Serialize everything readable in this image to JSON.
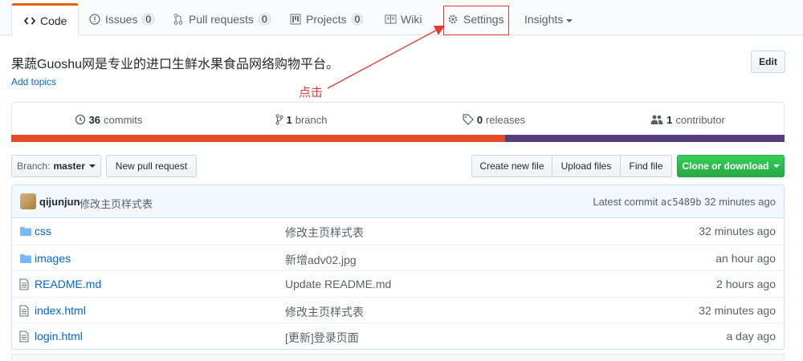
{
  "tabs": [
    {
      "label": "Code",
      "icon": "code-icon"
    },
    {
      "label": "Issues",
      "count": "0",
      "icon": "issue-icon"
    },
    {
      "label": "Pull requests",
      "count": "0",
      "icon": "pull-request-icon"
    },
    {
      "label": "Projects",
      "count": "0",
      "icon": "project-icon"
    },
    {
      "label": "Wiki",
      "icon": "book-icon"
    },
    {
      "label": "Settings",
      "icon": "gear-icon"
    },
    {
      "label": "Insights",
      "icon": "chevron-down-icon"
    }
  ],
  "repo": {
    "description": "果蔬Guoshu网是专业的进口生鲜水果食品网络购物平台。",
    "add_topics": "Add topics",
    "edit_label": "Edit"
  },
  "annotation": {
    "text": "点击",
    "color": "#e53935"
  },
  "summary": {
    "commits_count": "36",
    "commits_label": "commits",
    "branches_count": "1",
    "branches_label": "branch",
    "releases_count": "0",
    "releases_label": "releases",
    "contributors_count": "1",
    "contributors_label": "contributor"
  },
  "language_bar": [
    {
      "color": "#e34c26",
      "share": 0.639
    },
    {
      "color": "#563d7c",
      "share": 0.361
    }
  ],
  "file_nav": {
    "branch_label": "Branch:",
    "branch_value": "master",
    "new_pr": "New pull request",
    "create_file": "Create new file",
    "upload_files": "Upload files",
    "find_file": "Find file",
    "clone": "Clone or download"
  },
  "commit_tease": {
    "author": "qijunjun",
    "message": "修改主页样式表",
    "latest_label": "Latest commit",
    "sha": "ac5489b",
    "age": "32 minutes ago"
  },
  "files": [
    {
      "name": "css",
      "type": "dir",
      "message": "修改主页样式表",
      "age": "32 minutes ago"
    },
    {
      "name": "images",
      "type": "dir",
      "message": "新增adv02.jpg",
      "age": "an hour ago"
    },
    {
      "name": "README.md",
      "type": "file",
      "message": "Update README.md",
      "age": "2 hours ago"
    },
    {
      "name": "index.html",
      "type": "file",
      "message": "修改主页样式表",
      "age": "32 minutes ago"
    },
    {
      "name": "login.html",
      "type": "file",
      "message": "[更新]登录页面",
      "age": "a day ago"
    }
  ]
}
